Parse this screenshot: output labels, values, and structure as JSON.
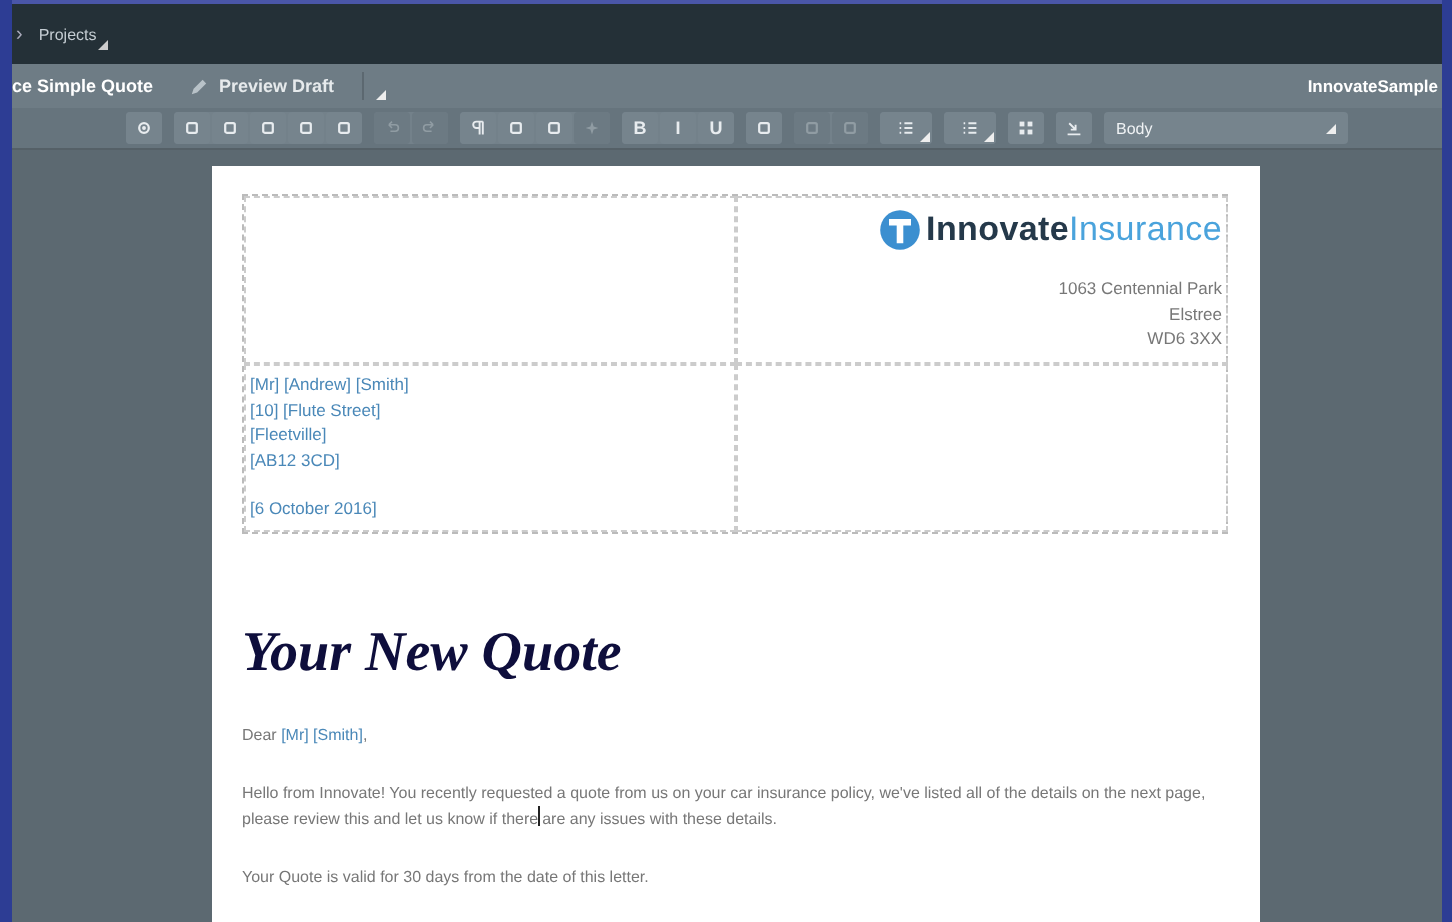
{
  "breadcrumb": {
    "separator": "›",
    "label": "Projects"
  },
  "tabs": [
    {
      "label": "ce Simple Quote",
      "kind": "text",
      "selected": true
    },
    {
      "label": "Preview Draft",
      "kind": "pencil",
      "selected": false
    }
  ],
  "workspace": "InnovateSample",
  "toolbar": {
    "groups": [
      [
        {
          "disabled": false
        }
      ],
      [
        {
          "disabled": false
        },
        {
          "disabled": false
        },
        {
          "disabled": false
        },
        {
          "disabled": false
        },
        {
          "disabled": false
        }
      ],
      [
        {
          "disabled": true
        },
        {
          "disabled": true
        }
      ],
      [
        {
          "disabled": false
        },
        {
          "disabled": false
        },
        {
          "disabled": false
        },
        {
          "disabled": true
        }
      ],
      [
        {
          "label": "B",
          "disabled": false
        },
        {
          "label": "I",
          "disabled": false
        },
        {
          "label": "U",
          "disabled": false
        }
      ],
      [
        {
          "disabled": false
        }
      ],
      [
        {
          "disabled": true
        },
        {
          "disabled": true
        }
      ],
      [
        {
          "disabled": false,
          "dropdown": true
        }
      ],
      [
        {
          "disabled": false,
          "dropdown": true
        }
      ],
      [
        {
          "disabled": false
        }
      ],
      [
        {
          "disabled": false
        }
      ]
    ],
    "style": "Body"
  },
  "document": {
    "brand_name": "Innovate",
    "brand_suffix": "Insurance",
    "company_address": [
      "1063 Centennial Park",
      "Elstree",
      "WD6 3XX"
    ],
    "recipient": [
      "[Mr] [Andrew] [Smith]",
      "[10] [Flute Street]",
      "[Fleetville]",
      "[AB12 3CD]"
    ],
    "date": "[6 October 2016]",
    "heading": "Your New Quote",
    "greeting": [
      {
        "kind": "plain",
        "text": "Dear "
      },
      {
        "kind": "field",
        "text": "[Mr]  [Smith]"
      },
      {
        "kind": "plain",
        "text": ","
      }
    ],
    "paragraphs": [
      [
        {
          "kind": "plain",
          "text": "Hello from Innovate! You recently requested a quote from us on your car insurance policy, we've listed all of the details on the next page, please review this and let us know if there"
        },
        {
          "kind": "cursor"
        },
        {
          "kind": "plain",
          "text": "are any issues with these details."
        }
      ],
      [
        {
          "kind": "plain",
          "text": "Your Quote is valid for 30 days from the date of this letter."
        }
      ]
    ]
  }
}
